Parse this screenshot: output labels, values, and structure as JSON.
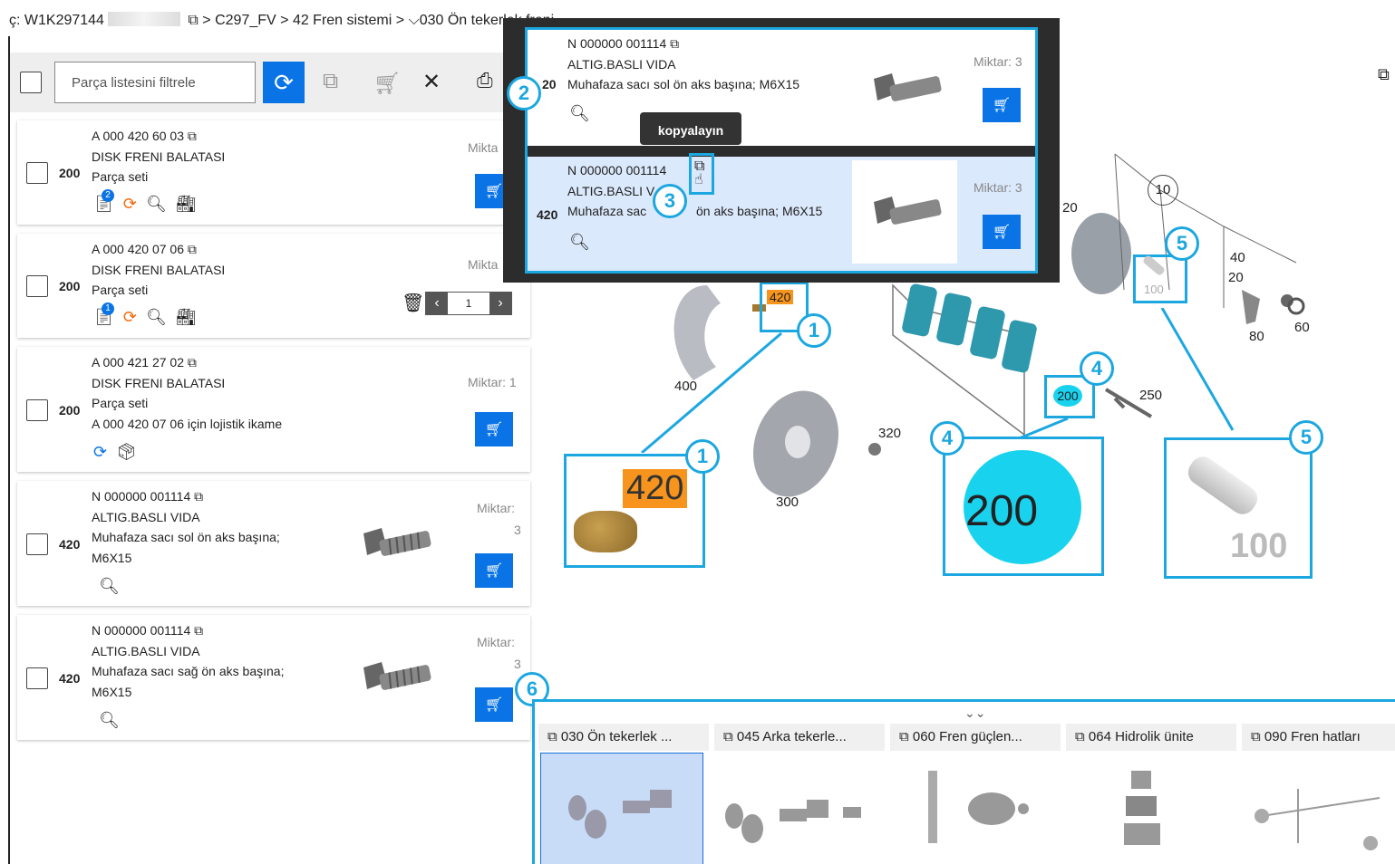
{
  "breadcrumb": {
    "prefix": "ç: W1K297144",
    "items": [
      "C297_FV",
      "42 Fren sistemi",
      "030 Ön tekerlek freni"
    ],
    "sep": ">"
  },
  "toolbar": {
    "filter_placeholder": "Parça listesini filtrele"
  },
  "parts": [
    {
      "number": "A 000 420 60 03",
      "name": "DISK FRENI BALATASI",
      "qty": "200",
      "desc": "Parça seti",
      "miktar": "Mikta",
      "badge": "2"
    },
    {
      "number": "A 000 420 07 06",
      "name": "DISK FRENI BALATASI",
      "qty": "200",
      "desc": "Parça seti",
      "miktar": "Mikta",
      "badge": "1",
      "stepper": "1"
    },
    {
      "number": "A 000 421 27 02",
      "name": "DISK FRENI BALATASI",
      "qty": "200",
      "desc": "Parça seti",
      "desc2": "A 000 420 07 06 için lojistik ikame",
      "miktar": "Miktar: 1"
    },
    {
      "number": "N 000000 001114",
      "name": "ALTIG.BASLI VIDA",
      "qty": "420",
      "desc": "Muhafaza sacı sol ön aks başına;",
      "desc2": "M6X15",
      "miktar": "Miktar:",
      "miktar_val": "3"
    },
    {
      "number": "N 000000 001114",
      "name": "ALTIG.BASLI VIDA",
      "qty": "420",
      "desc": "Muhafaza sacı sağ ön aks başına;",
      "desc2": "M6X15",
      "miktar": "Miktar:",
      "miktar_val": "3"
    }
  ],
  "popup": {
    "rows": [
      {
        "number": "N 000000 001114",
        "name": "ALTIG.BASLI VIDA",
        "qty": "20",
        "desc": "Muhafaza sacı sol ön aks başına; M6X15",
        "miktar": "Miktar: 3"
      },
      {
        "number": "N 000000 001114",
        "name": "ALTIG.BASLI V",
        "qty": "420",
        "desc": "Muhafaza sac",
        "desc_rest": "ön aks başına; M6X15",
        "miktar": "Miktar: 3"
      }
    ],
    "tooltip": "kopyalayın"
  },
  "diagram": {
    "labels": [
      "420",
      "400",
      "320",
      "300",
      "200",
      "250",
      "10",
      "40",
      "20",
      "60",
      "80",
      "100",
      "20"
    ],
    "zoom_420": "420",
    "zoom_200": "200",
    "zoom_100": "100"
  },
  "callouts": [
    "1",
    "2",
    "3",
    "4",
    "5",
    "6"
  ],
  "tabs": [
    {
      "label": "030 Ön tekerlek ..."
    },
    {
      "label": "045 Arka tekerle..."
    },
    {
      "label": "060 Fren güçlen..."
    },
    {
      "label": "064 Hidrolik ünite"
    },
    {
      "label": "090 Fren hatları"
    }
  ],
  "colors": {
    "accent": "#0a74e6",
    "callout": "#1ca7e0",
    "highlight_orange": "#f7941d",
    "highlight_cyan": "#19d3ee"
  }
}
